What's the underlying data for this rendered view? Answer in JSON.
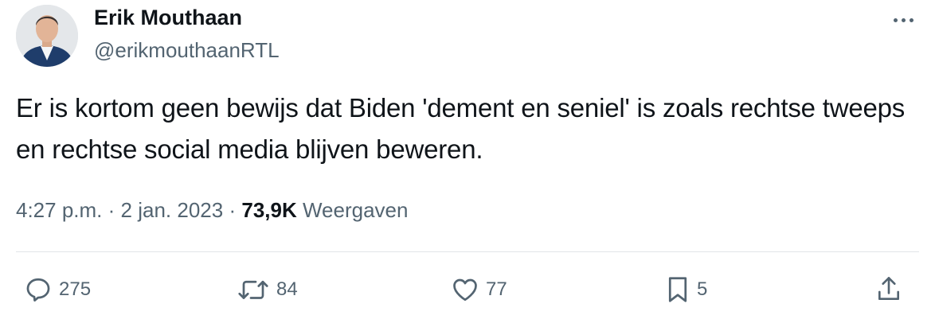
{
  "author": {
    "name": "Erik Mouthaan",
    "handle": "@erikmouthaanRTL"
  },
  "tweet": {
    "text": "Er is kortom geen bewijs dat Biden 'dement en seniel' is zoals rechtse tweeps en rechtse social media blijven beweren.",
    "time": "4:27 p.m.",
    "separator": "·",
    "date": "2 jan. 2023",
    "views_count": "73,9K",
    "views_label": "Weergaven"
  },
  "actions": {
    "replies": "275",
    "retweets": "84",
    "likes": "77",
    "bookmarks": "5"
  },
  "icons": {
    "more": "more-horizontal-icon",
    "reply": "reply-icon",
    "retweet": "retweet-icon",
    "like": "heart-icon",
    "bookmark": "bookmark-icon",
    "share": "share-icon"
  },
  "colors": {
    "text": "#0f1419",
    "secondary": "#536471",
    "divider": "#e1e5e8"
  }
}
